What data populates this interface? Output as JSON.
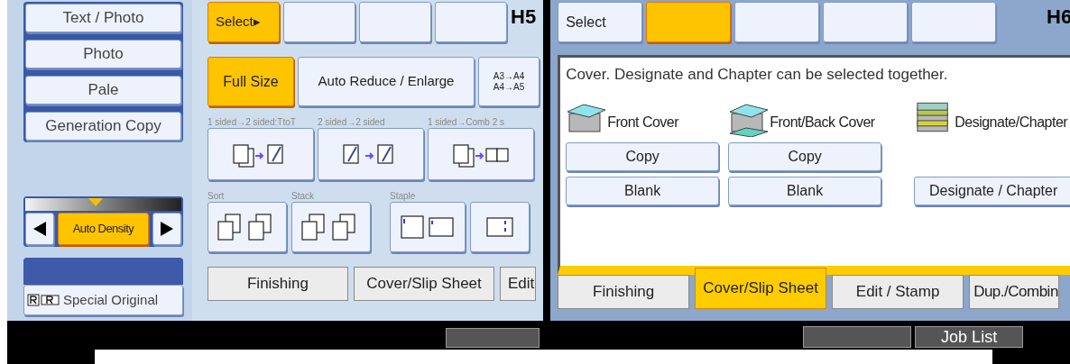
{
  "left_panel": {
    "label": "H5",
    "image_modes": [
      {
        "label": "Text / Photo"
      },
      {
        "label": "Photo"
      },
      {
        "label": "Pale"
      },
      {
        "label": "Generation Copy"
      }
    ],
    "density": {
      "label": "Auto Density",
      "level": 0.45,
      "selected": true
    },
    "special_original": {
      "label": "Special Original"
    },
    "top_buttons": [
      {
        "label": "Select▸",
        "selected": true
      },
      {
        "selected": false
      },
      {
        "selected": false
      },
      {
        "selected": false
      }
    ],
    "ratio_buttons": [
      {
        "label": "Full Size",
        "selected": true
      },
      {
        "label": "Auto Reduce / Enlarge",
        "selected": false
      },
      {
        "lines": [
          "A3→A4",
          "A4→A5"
        ],
        "selected": false
      }
    ],
    "duplex": [
      {
        "label": "1 sided→2 sided:TtoT",
        "kind": "one-to-two"
      },
      {
        "label": "2 sided→2 sided",
        "kind": "two-to-two"
      },
      {
        "label": "1 sided→Comb 2 s",
        "kind": "one-to-comb"
      }
    ],
    "finishing": [
      {
        "group": "Sort",
        "kind": "sort"
      },
      {
        "group": "Stack",
        "kind": "stack"
      },
      {
        "group": "Staple",
        "kind": "staple-pair"
      },
      {
        "kind": "staple-side"
      }
    ],
    "tabs": [
      {
        "label": "Finishing",
        "selected": false
      },
      {
        "label": "Cover/Slip Sheet",
        "selected": false
      },
      {
        "label": "Edit",
        "selected": false
      }
    ]
  },
  "right_panel": {
    "label": "H6",
    "top_buttons": [
      {
        "label": "Select",
        "selected": false
      },
      {
        "selected": true
      },
      {
        "selected": false
      },
      {
        "selected": false
      },
      {
        "selected": false
      }
    ],
    "message": "Cover. Designate and Chapter can be selected together.",
    "sections": [
      {
        "title": "Front Cover",
        "kind": "front",
        "buttons": [
          "Copy",
          "Blank"
        ]
      },
      {
        "title": "Front/Back Cover",
        "kind": "front-back",
        "buttons": [
          "Copy",
          "Blank"
        ]
      },
      {
        "title": "Designate/Chapter",
        "kind": "designate",
        "buttons": [
          "Designate / Chapter"
        ]
      }
    ],
    "tabs": [
      {
        "label": "Finishing",
        "selected": false
      },
      {
        "label": "Cover/Slip Sheet",
        "selected": true
      },
      {
        "label": "Edit / Stamp",
        "selected": false
      },
      {
        "label": "Dup./Combin",
        "selected": false
      }
    ],
    "system_buttons": [
      "Job List"
    ]
  }
}
